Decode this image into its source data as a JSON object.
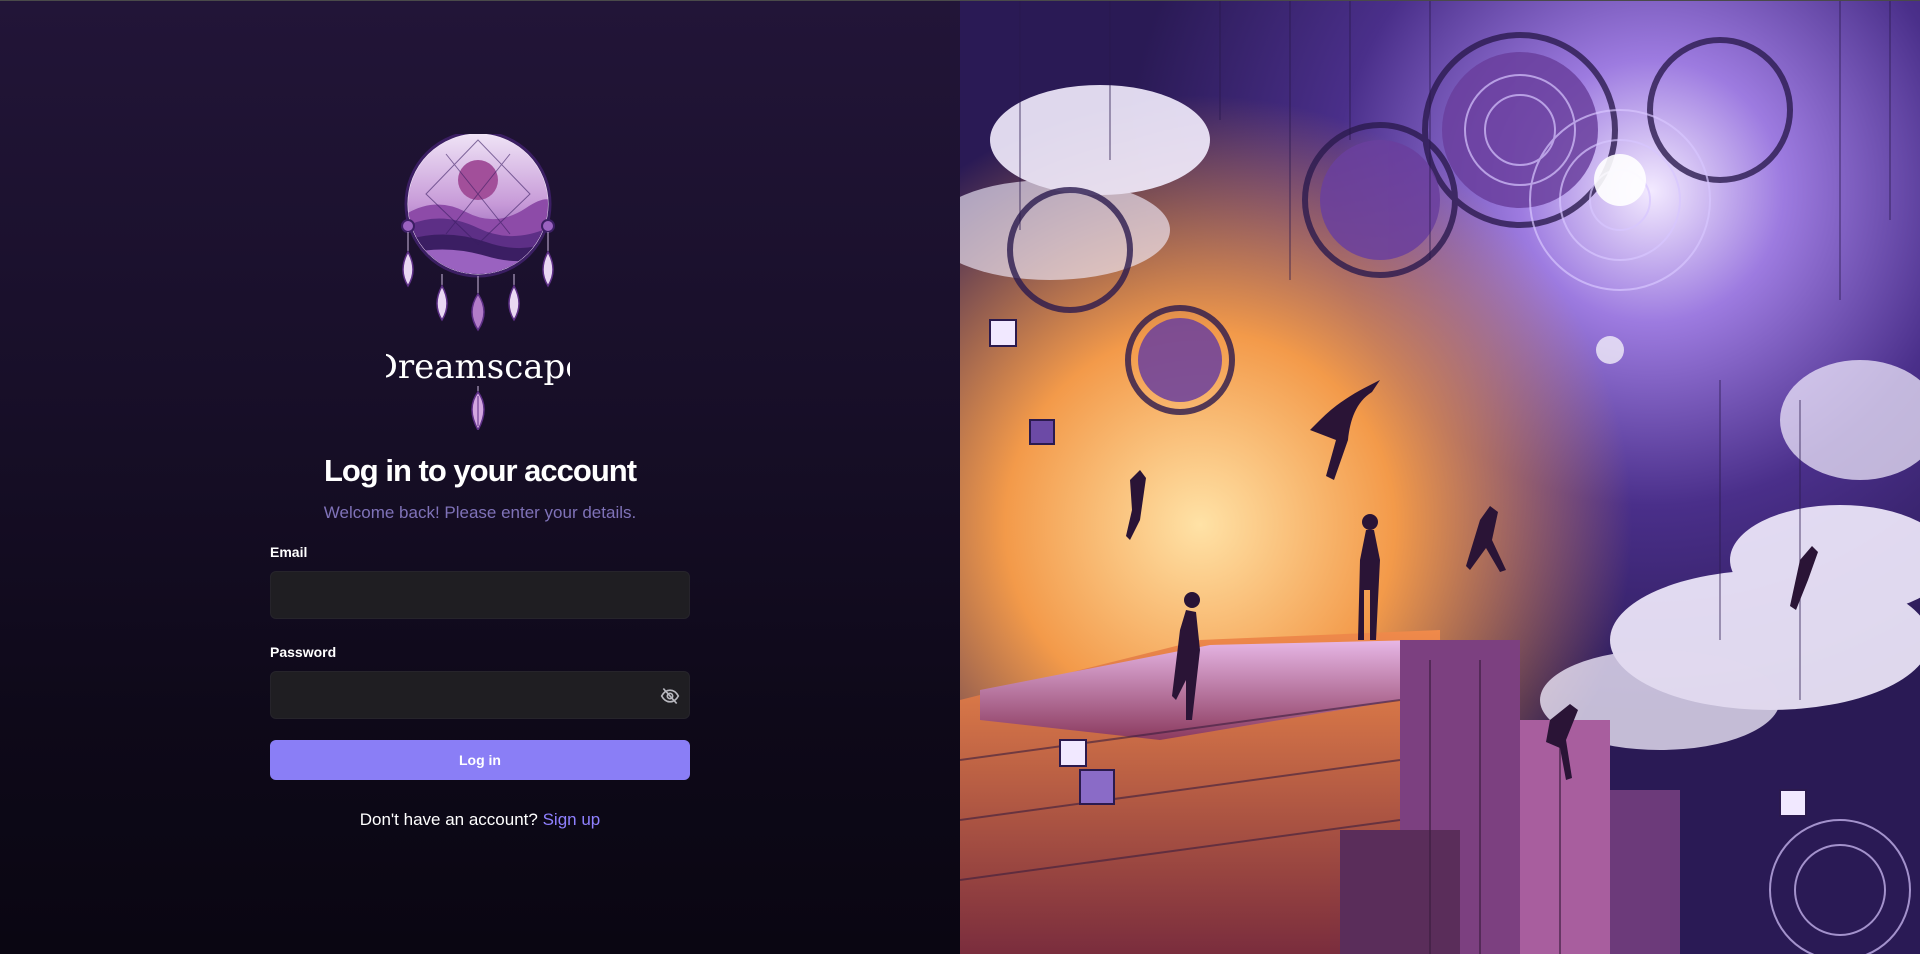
{
  "brand": {
    "name": "Dreamscape",
    "logo_icon": "dreamcatcher-logo-icon"
  },
  "login": {
    "title": "Log in to your account",
    "subtitle": "Welcome back! Please enter your details.",
    "email_label": "Email",
    "email_value": "",
    "password_label": "Password",
    "password_value": "",
    "password_toggle_icon": "eye-off-icon",
    "submit_label": "Log in",
    "signup_prompt": "Don't have an account?",
    "signup_link": "Sign up"
  },
  "colors": {
    "accent": "#8a7ef6",
    "link": "#8f80ff",
    "subtitle": "#7f72b8",
    "input_bg": "#1f1e22"
  },
  "hero": {
    "image_icon": "dreamscape-artwork-illustration"
  }
}
